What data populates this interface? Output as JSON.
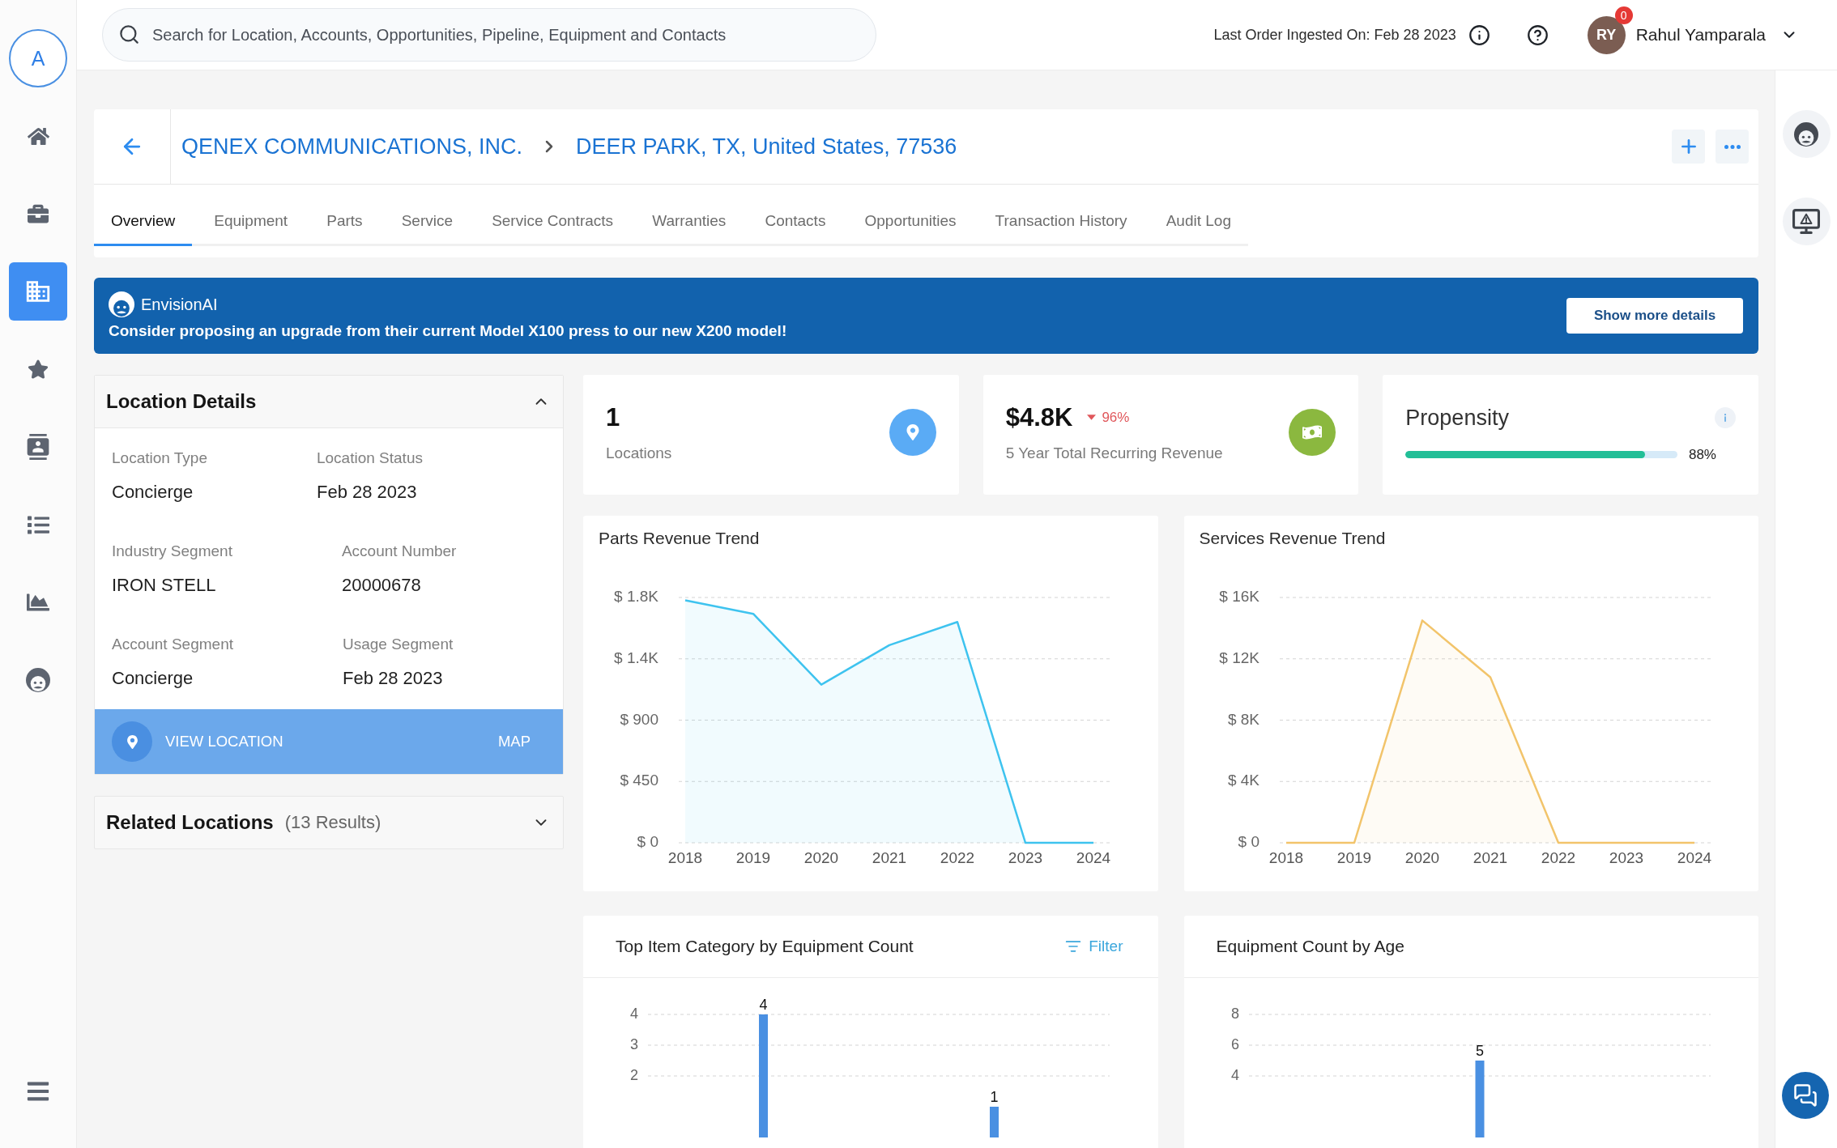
{
  "sidebar": {
    "avatar": "A",
    "items": [
      {
        "selected": false
      },
      {
        "selected": false
      },
      {
        "selected": true
      },
      {
        "selected": false
      },
      {
        "selected": false
      },
      {
        "selected": false
      },
      {
        "selected": false
      },
      {
        "selected": false
      }
    ]
  },
  "search": {
    "placeholder": "Search for Location, Accounts, Opportunities, Pipeline, Equipment and Contacts"
  },
  "last_order": "Last Order Ingested On: Feb 28 2023",
  "user": {
    "initials": "RY",
    "notifications": "0",
    "name": "Rahul Yamparala"
  },
  "breadcrumb": [
    "QENEX COMMUNICATIONS, INC.",
    "DEER PARK, TX, United States, 77536"
  ],
  "tabs": [
    {
      "label": "Overview",
      "selected": true
    },
    {
      "label": "Equipment",
      "selected": false
    },
    {
      "label": "Parts",
      "selected": false
    },
    {
      "label": "Service",
      "selected": false
    },
    {
      "label": "Service Contracts",
      "selected": false
    },
    {
      "label": "Warranties",
      "selected": false
    },
    {
      "label": "Contacts",
      "selected": false
    },
    {
      "label": "Opportunities",
      "selected": false
    },
    {
      "label": "Transaction History",
      "selected": false
    },
    {
      "label": "Audit Log",
      "selected": false
    }
  ],
  "banner": {
    "title": "EnvisionAI",
    "message": "Consider proposing an upgrade from their current Model X100 press to our new X200 model!",
    "button": "Show more details"
  },
  "location_details": {
    "title": "Location Details",
    "expanded": true,
    "rows": [
      [
        {
          "label": "Location Type",
          "value": "Concierge"
        },
        {
          "label": "Location Status",
          "value": "Feb 28 2023"
        }
      ],
      [
        {
          "label": "Industry Segment",
          "value": "IRON STELL"
        },
        {
          "label": "Account Number",
          "value": "20000678"
        }
      ],
      [
        {
          "label": "Account Segment",
          "value": "Concierge"
        },
        {
          "label": "Usage Segment",
          "value": "Feb 28 2023"
        }
      ]
    ],
    "view_location": "VIEW LOCATION",
    "map": "MAP"
  },
  "related_locations": {
    "title": "Related Locations",
    "count": "(13 Results)",
    "expanded": false
  },
  "kpis": [
    {
      "kind": "count",
      "value": "1",
      "label": "Locations"
    },
    {
      "kind": "revenue",
      "value": "$4.8K",
      "decreasing": true,
      "change": "96%",
      "label": "5 Year Total Recurring Revenue"
    },
    {
      "kind": "propensity",
      "label": "Propensity",
      "level": 0.88,
      "reading": "88%"
    }
  ],
  "trend_charts": [
    {
      "title": "Parts Revenue Trend",
      "chart_data": {
        "type": "area",
        "categories": [
          "2018",
          "2019",
          "2020",
          "2021",
          "2022",
          "2023",
          "2024"
        ],
        "series": [
          {
            "color": "#3ec3ef",
            "values": [
              1780,
              1680,
              1160,
              1450,
              1620,
              0,
              0
            ]
          }
        ],
        "ylim": [
          0,
          1800
        ],
        "yticks": [
          {
            "value": 0,
            "label": "$ 0"
          },
          {
            "value": 450,
            "label": "$ 450"
          },
          {
            "value": 900,
            "label": "$ 900"
          },
          {
            "value": 1350,
            "label": "$ 1.4K"
          },
          {
            "value": 1800,
            "label": "$ 1.8K"
          }
        ],
        "grid": true
      }
    },
    {
      "title": "Services Revenue Trend",
      "chart_data": {
        "type": "area",
        "categories": [
          "2018",
          "2019",
          "2020",
          "2021",
          "2022",
          "2023",
          "2024"
        ],
        "series": [
          {
            "color": "#f2c46b",
            "values": [
              0,
              0,
              14500,
              10800,
              0,
              0,
              0
            ]
          }
        ],
        "ylim": [
          0,
          16000
        ],
        "yticks": [
          {
            "value": 0,
            "label": "$ 0"
          },
          {
            "value": 4000,
            "label": "$ 4K"
          },
          {
            "value": 8000,
            "label": "$ 8K"
          },
          {
            "value": 12000,
            "label": "$ 12K"
          },
          {
            "value": 16000,
            "label": "$ 16K"
          }
        ],
        "grid": true
      }
    }
  ],
  "equipment_charts": [
    {
      "title": "Top Item Category by Equipment Count",
      "filter": "Filter",
      "chart_data": {
        "type": "bar",
        "values": [
          4,
          1
        ],
        "ylim": [
          0,
          4
        ],
        "yticks": [
          2,
          3,
          4
        ],
        "grid": true,
        "data_labels": true
      }
    },
    {
      "title": "Equipment Count by Age",
      "chart_data": {
        "type": "bar",
        "values": [
          5
        ],
        "ylim": [
          0,
          8
        ],
        "yticks": [
          4,
          6,
          8
        ],
        "grid": true,
        "data_labels": true
      }
    }
  ]
}
